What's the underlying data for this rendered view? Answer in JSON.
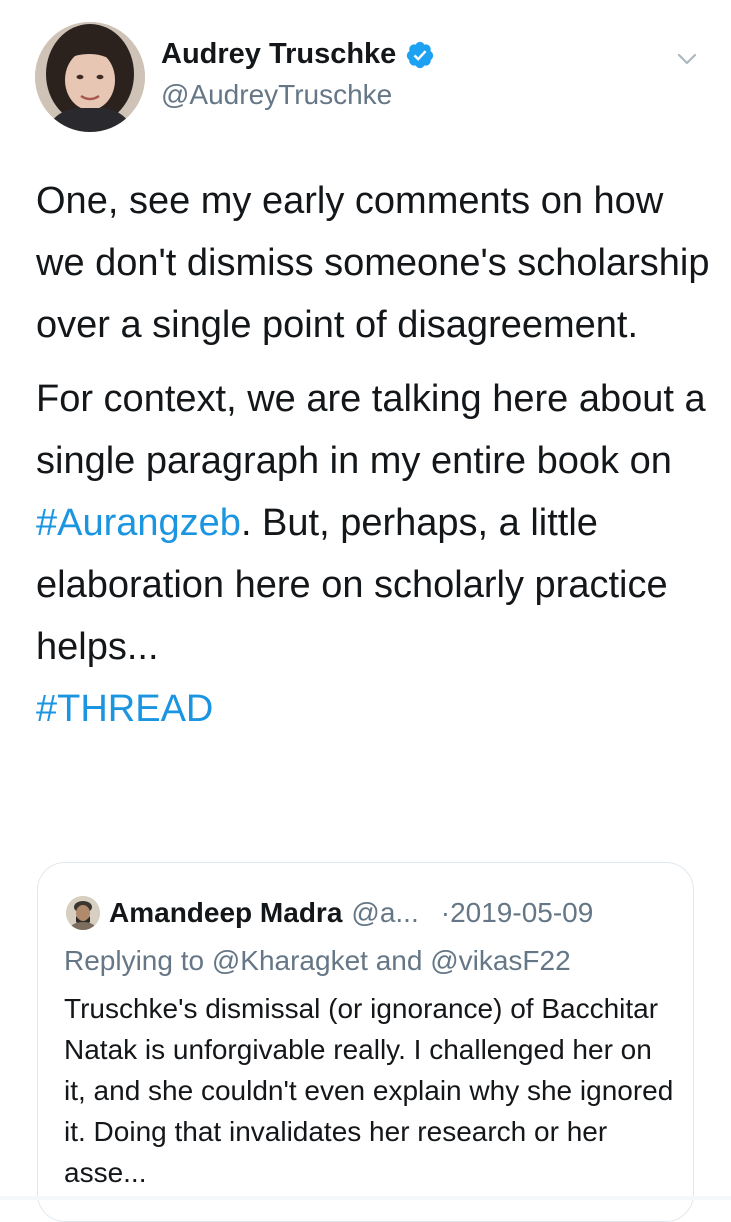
{
  "author": {
    "display_name": "Audrey Truschke",
    "handle": "@AudreyTruschke",
    "verified": true,
    "avatar_icon": "profile-photo"
  },
  "tweet": {
    "paragraph1": "One, see my early comments on how we don't dismiss someone's scholarship over a single point of disagreement.",
    "paragraph2_before": "For context, we are talking here about a single paragraph in my entire book on ",
    "paragraph2_hashtag": "#Aurangzeb",
    "paragraph2_after": ". But, perhaps, a little elaboration here on scholarly practice helps...",
    "thread_hashtag": "#THREAD"
  },
  "quoted_tweet": {
    "display_name": "Amandeep Madra",
    "handle": "@a...",
    "date": "·2019-05-09",
    "replying_to": "Replying to @Kharagket and @vikasF22",
    "body": "Truschke's dismissal (or ignorance) of Bacchitar Natak is unforgivable really. I challenged her on it, and she couldn't even explain why she ignored it. Doing that invalidates her research or her asse..."
  },
  "colors": {
    "link": "#1b95e0",
    "secondary_text": "#657786",
    "primary_text": "#14171a",
    "verified_badge": "#1da1f2",
    "card_border": "#e1e8ed"
  },
  "icons": {
    "verified": "verified-badge-icon",
    "caret": "chevron-down-icon"
  }
}
